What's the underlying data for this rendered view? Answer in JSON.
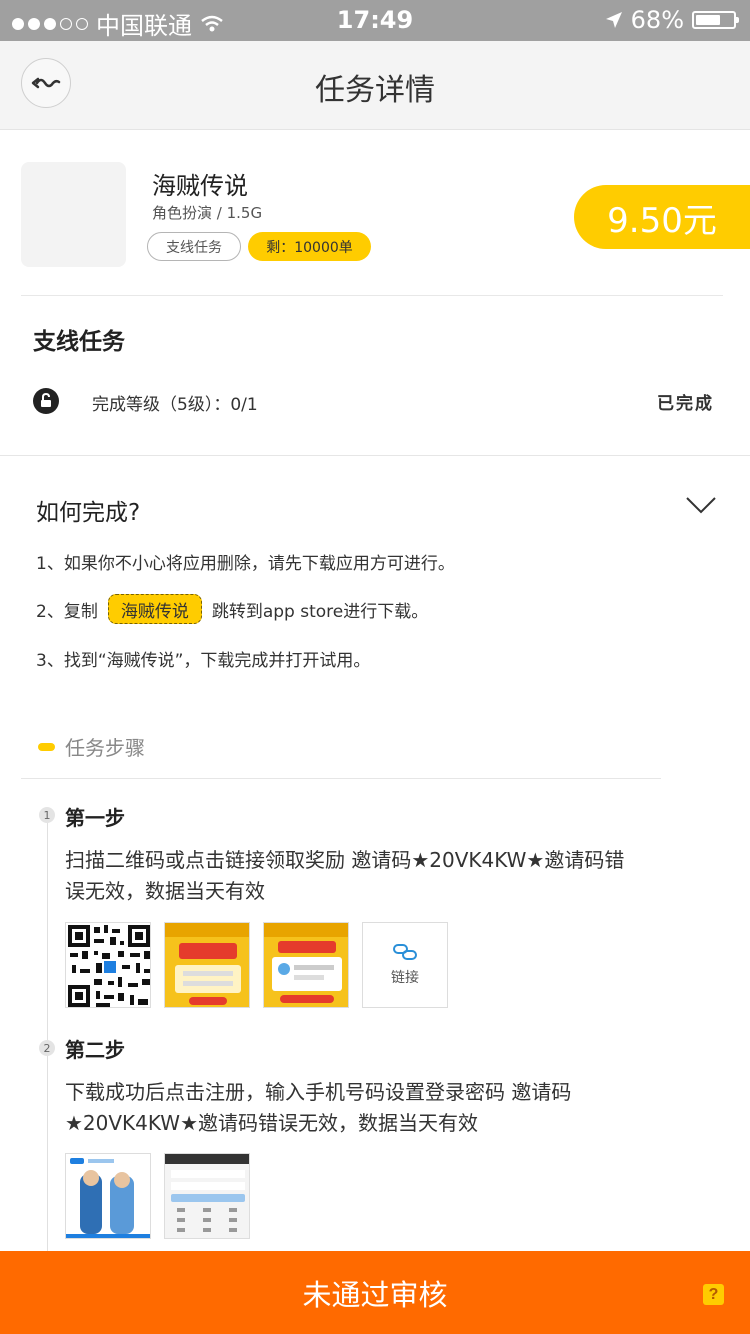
{
  "status_bar": {
    "carrier": "中国联通",
    "time": "17:49",
    "battery_percent": "68%",
    "battery_level": 0.68,
    "signal_filled": 3,
    "signal_total": 5
  },
  "nav": {
    "title": "任务详情",
    "back_icon": "back-icon"
  },
  "app": {
    "name": "海贼传说",
    "meta": "角色扮演 / 1.5G",
    "tag_type": "支线任务",
    "tag_remaining": "剩：10000单",
    "price": "9.50元"
  },
  "branch": {
    "title": "支线任务",
    "level_text": "完成等级（5级）：0/1",
    "status": "已完成"
  },
  "how": {
    "title": "如何完成?",
    "step1": "1、如果你不小心将应用删除，请先下载应用方可进行。",
    "step2_prefix": "2、复制",
    "step2_chip": "海贼传说",
    "step2_suffix": "跳转到app store进行下载。",
    "step3": "3、找到“海贼传说”，下载完成并打开试用。"
  },
  "steps_section": {
    "label": "任务步骤",
    "steps": [
      {
        "num": "1",
        "title": "第一步",
        "desc": "扫描二维码或点击链接领取奖励 邀请码★20VK4KW★邀请码错误无效，数据当天有效",
        "link_label": "链接"
      },
      {
        "num": "2",
        "title": "第二步",
        "desc": "下载成功后点击注册，输入手机号码设置登录密码 邀请码★20VK4KW★邀请码错误无效，数据当天有效"
      }
    ]
  },
  "bottom": {
    "label": "未通过审核",
    "help": "?"
  },
  "colors": {
    "accent_yellow": "#ffcc00",
    "bottom_orange": "#ff6a00",
    "status_gray": "#a0a0a0"
  }
}
